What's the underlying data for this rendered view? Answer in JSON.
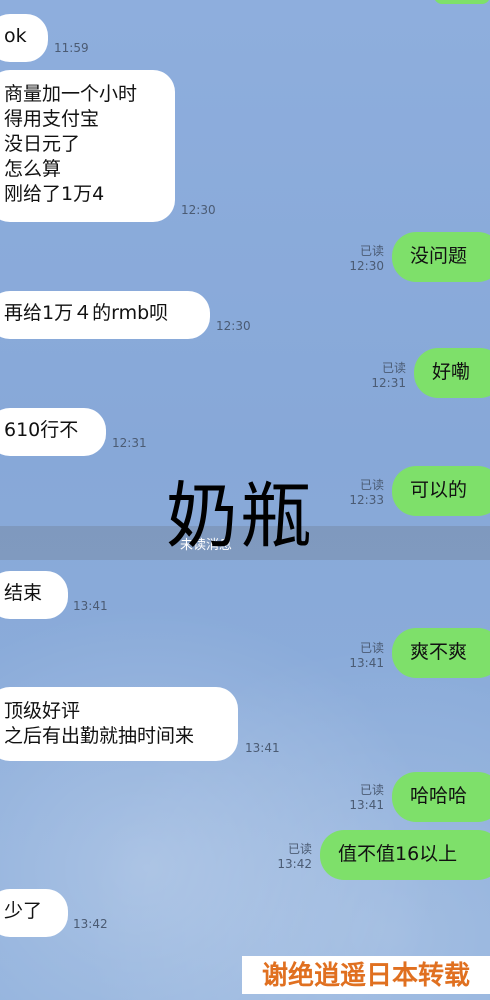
{
  "messages": [
    {
      "text": "ok",
      "time": "11:59"
    },
    {
      "text": "商量加一个小时\n得用支付宝\n没日元了\n怎么算\n刚给了1万4",
      "time": "12:30"
    },
    {
      "text": "没问题",
      "read": "已读",
      "time": "12:30"
    },
    {
      "text": "再给1万４的rmb呗",
      "time": "12:30"
    },
    {
      "text": "好嘞",
      "read": "已读",
      "time": "12:31"
    },
    {
      "text": "610行不",
      "time": "12:31"
    },
    {
      "text": "可以的",
      "read": "已读",
      "time": "12:33"
    },
    {
      "text": "结束",
      "time": "13:41"
    },
    {
      "text": "爽不爽",
      "read": "已读",
      "time": "13:41"
    },
    {
      "text": "顶级好评\n之后有出勤就抽时间来",
      "time": "13:41"
    },
    {
      "text": "哈哈哈",
      "read": "已读",
      "time": "13:41"
    },
    {
      "text": "值不值16以上",
      "read": "已读",
      "time": "13:42"
    },
    {
      "text": "少了",
      "time": "13:42"
    }
  ],
  "divider_text": "未读消息",
  "overlay_text": "奶瓶",
  "watermark_text": "谢绝逍遥日本转载",
  "colors": {
    "incoming": "#ffffff",
    "outgoing": "#7ee06a",
    "background": "#8eaedd",
    "watermark": "#e07020"
  }
}
